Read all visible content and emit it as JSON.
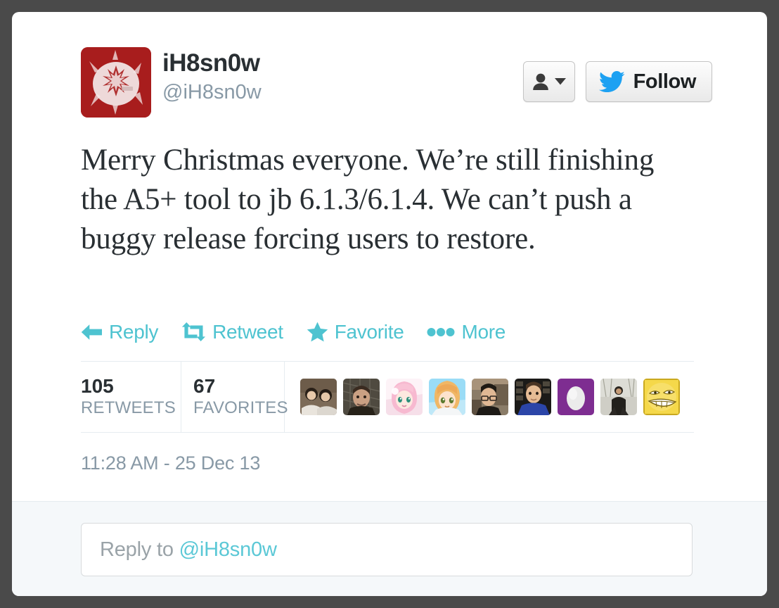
{
  "tweet": {
    "author": {
      "display_name": "iH8sn0w",
      "screen_name": "@iH8sn0w",
      "avatar_name": "ih8sn0w-avatar",
      "avatar_bg_color": "#a81d1d"
    },
    "follow_controls": {
      "user_menu_icon": "user-dropdown-icon",
      "follow_label": "Follow",
      "follow_icon": "twitter-bird-icon"
    },
    "text": "Merry Christmas everyone. We’re still finishing the A5+ tool to jb 6.1.3/6.1.4. We can’t push a buggy release forcing users to restore.",
    "actions": [
      {
        "label": "Reply",
        "icon": "reply-arrow-icon"
      },
      {
        "label": "Retweet",
        "icon": "retweet-icon"
      },
      {
        "label": "Favorite",
        "icon": "star-icon"
      },
      {
        "label": "More",
        "icon": "ellipsis-icon"
      }
    ],
    "stats": {
      "retweets_count": "105",
      "retweets_label": "RETWEETS",
      "favorites_count": "67",
      "favorites_label": "FAVORITES"
    },
    "facepile": [
      {
        "name": "facepile-avatar-1",
        "bg": "#6b5a4a"
      },
      {
        "name": "facepile-avatar-2",
        "bg": "#4a4238"
      },
      {
        "name": "facepile-avatar-3",
        "bg": "#f2d6e2"
      },
      {
        "name": "facepile-avatar-4",
        "bg": "#8fd4f0"
      },
      {
        "name": "facepile-avatar-5",
        "bg": "#3c3a36"
      },
      {
        "name": "facepile-avatar-6",
        "bg": "#1f2f66"
      },
      {
        "name": "facepile-avatar-7",
        "bg": "#7b2d8e"
      },
      {
        "name": "facepile-avatar-8",
        "bg": "#b9bcb4"
      },
      {
        "name": "facepile-avatar-9",
        "bg": "#f2d24b"
      }
    ],
    "timestamp": "11:28 AM - 25 Dec 13",
    "reply": {
      "placeholder_prefix": "Reply to ",
      "placeholder_mention": "@iH8sn0w"
    }
  },
  "colors": {
    "accent_teal": "#4ec3d0",
    "twitter_blue": "#1da1f2",
    "page_background": "#4a4a4a",
    "card_background": "#ffffff",
    "footer_background": "#f5f8fa",
    "muted_text": "#8899a6",
    "primary_text": "#292f33"
  }
}
